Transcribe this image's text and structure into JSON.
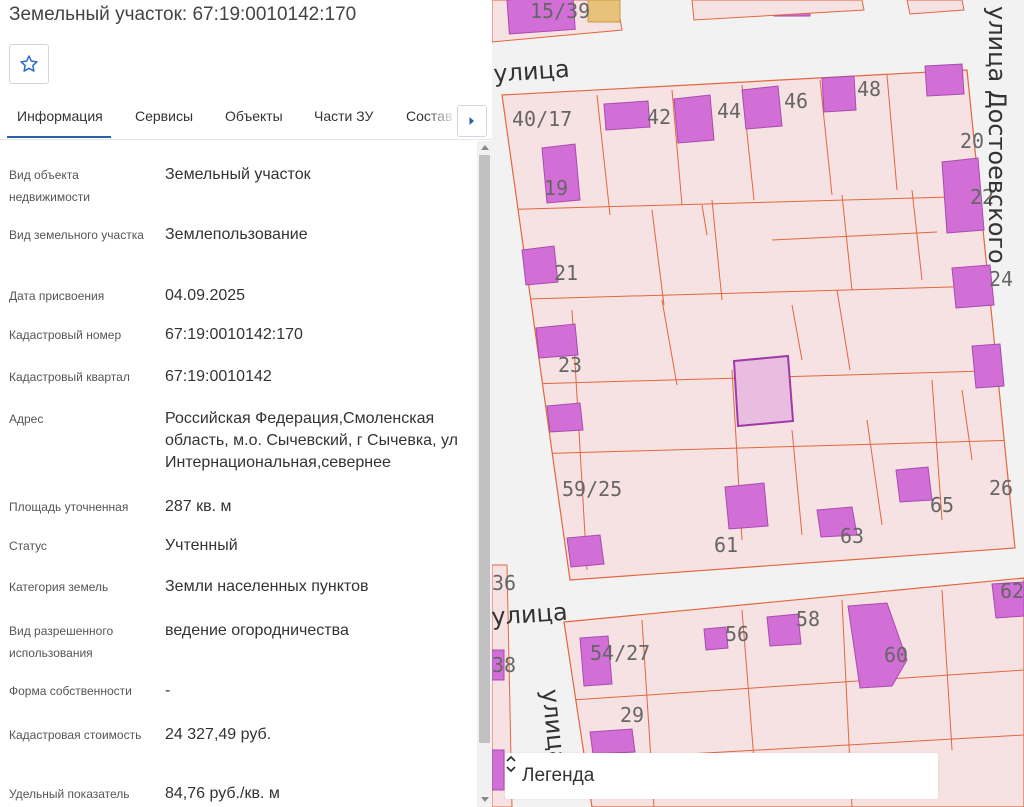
{
  "header": {
    "title": "Земельный участок: 67:19:0010142:170",
    "favorite_icon": "star-outline-icon"
  },
  "tabs": [
    {
      "label": "Информация",
      "active": true
    },
    {
      "label": "Сервисы"
    },
    {
      "label": "Объекты"
    },
    {
      "label": "Части ЗУ"
    },
    {
      "label": "Состав"
    }
  ],
  "tab_next_icon": "caret-right-icon",
  "accent_color": "#2b5fad",
  "info": [
    {
      "label": "Вид объекта недвижимости",
      "value": "Земельный участок"
    },
    {
      "label": "Вид земельного участка",
      "value": "Землепользование"
    },
    {
      "label": "Дата присвоения",
      "value": "04.09.2025"
    },
    {
      "label": "Кадастровый номер",
      "value": "67:19:0010142:170"
    },
    {
      "label": "Кадастровый квартал",
      "value": "67:19:0010142"
    },
    {
      "label": "Адрес",
      "value": "Российская Федерация,Смоленская область, м.о. Сычевский, г Сычевка, ул Интернациональная,севернее"
    },
    {
      "label": "Площадь уточненная",
      "value": "287 кв. м"
    },
    {
      "label": "Статус",
      "value": "Учтенный"
    },
    {
      "label": "Категория земель",
      "value": "Земли населенных пунктов"
    },
    {
      "label": "Вид разрешенного использования",
      "value": "ведение огородничества"
    },
    {
      "label": "Форма собственности",
      "value": "-"
    },
    {
      "label": "Кадастровая стоимость",
      "value": "24 327,49 руб."
    },
    {
      "label": "Удельный показатель",
      "value": "84,76 руб./кв. м"
    }
  ],
  "map": {
    "colors": {
      "parcel_fill": "#f6e2e2",
      "parcel_border": "#e2673f",
      "building_fill": "#d16fd6",
      "building_border": "#a84bb0",
      "selected_fill": "#e8bde0",
      "selected_border": "#a03aa8",
      "street": "#ffffff",
      "background": "#f2f2f2"
    },
    "street_labels": [
      "улица",
      "улица Достоевского",
      "улица",
      "улица"
    ],
    "house_numbers": [
      "15/39",
      "40/17",
      "42",
      "44",
      "46",
      "48",
      "20",
      "19",
      "22",
      "21",
      "24",
      "23",
      "59/25",
      "65",
      "26",
      "61",
      "63",
      "36",
      "54/27",
      "56",
      "58",
      "60",
      "62",
      "38",
      "29"
    ],
    "legend": {
      "label": "Легенда",
      "toggle_icon": "chevron-up-down-icon"
    }
  }
}
